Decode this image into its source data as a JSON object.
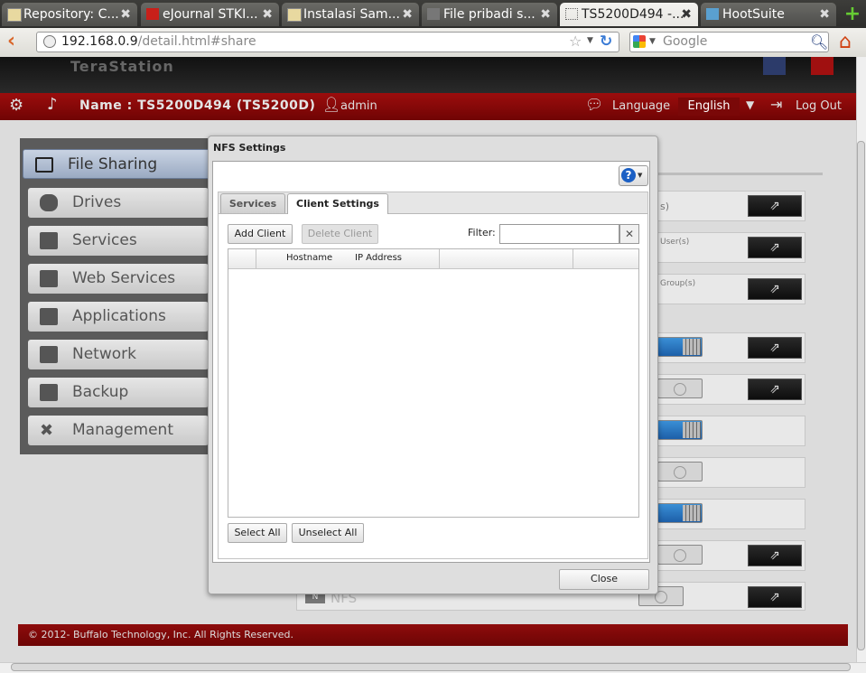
{
  "browser": {
    "tabs": [
      {
        "label": "Repository: C...",
        "active": false
      },
      {
        "label": "eJournal STKI...",
        "active": false
      },
      {
        "label": "Instalasi Sam...",
        "active": false
      },
      {
        "label": "File pribadi s...",
        "active": false
      },
      {
        "label": "TS5200D494 -...",
        "active": true
      },
      {
        "label": "HootSuite",
        "active": false
      }
    ],
    "tab_close": "✖",
    "new_tab": "+",
    "url_host": "192.168.0.9",
    "url_path": "/detail.html#share",
    "search_placeholder": "Google"
  },
  "app": {
    "brand": "TeraStation",
    "name_label": "Name : TS5200D494 (TS5200D)",
    "user": "admin",
    "language_label": "Language",
    "language_value": "English",
    "logout_label": "Log Out",
    "footer": "© 2012- Buffalo Technology, Inc. All Rights Reserved."
  },
  "sidebar": {
    "items": [
      {
        "label": "File Sharing",
        "active": true
      },
      {
        "label": "Drives"
      },
      {
        "label": "Services"
      },
      {
        "label": "Web Services"
      },
      {
        "label": "Applications"
      },
      {
        "label": "Network"
      },
      {
        "label": "Backup"
      },
      {
        "label": "Management"
      }
    ]
  },
  "content": {
    "row_labels": [
      "s)",
      "User(s)",
      "Group(s)"
    ],
    "nfs_badge": "N",
    "nfs_label": "NFS"
  },
  "dialog": {
    "title": "NFS Settings",
    "help": "?",
    "tabs": [
      "Services",
      "Client Settings"
    ],
    "active_tab": "Client Settings",
    "add_client": "Add Client",
    "delete_client": "Delete Client",
    "filter_label": "Filter:",
    "filter_value": "",
    "clear": "✕",
    "columns": [
      "Hostname",
      "IP Address"
    ],
    "rows": [],
    "select_all": "Select All",
    "unselect_all": "Unselect All",
    "close": "Close"
  }
}
